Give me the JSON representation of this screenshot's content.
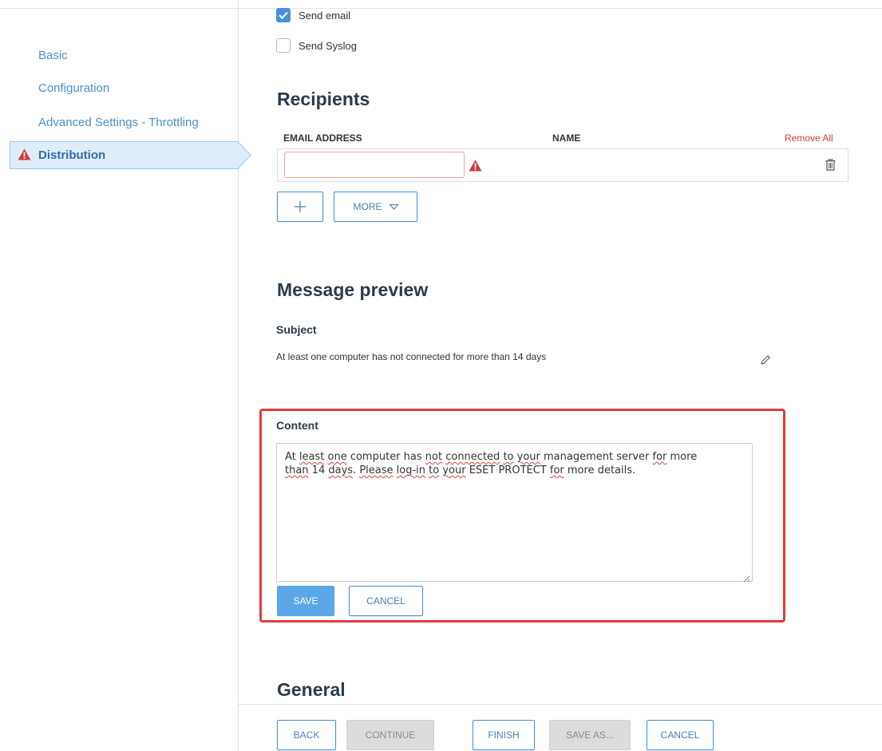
{
  "sidebar": {
    "items": [
      {
        "label": "Basic"
      },
      {
        "label": "Configuration"
      },
      {
        "label": "Advanced Settings - Throttling"
      },
      {
        "label": "Distribution",
        "active": true,
        "warning": true
      }
    ]
  },
  "distribution": {
    "send_email": {
      "label": "Send email",
      "checked": true
    },
    "send_syslog": {
      "label": "Send Syslog",
      "checked": false
    }
  },
  "recipients": {
    "title": "Recipients",
    "col_email": "EMAIL ADDRESS",
    "col_name": "NAME",
    "remove_all": "Remove All",
    "row": {
      "email_value": "",
      "has_error": true
    },
    "add_button_icon": "plus-icon",
    "more_label": "MORE"
  },
  "message_preview": {
    "title": "Message preview",
    "subject_label": "Subject",
    "subject_text": "At least one computer has not connected for more than 14 days",
    "content_label": "Content",
    "content_line1": [
      {
        "t": "At ",
        "sp": false
      },
      {
        "t": "least",
        "sp": true
      },
      {
        "t": " ",
        "sp": false
      },
      {
        "t": "one",
        "sp": true
      },
      {
        "t": " computer has ",
        "sp": false
      },
      {
        "t": "not",
        "sp": true
      },
      {
        "t": " ",
        "sp": false
      },
      {
        "t": "connected",
        "sp": true
      },
      {
        "t": " ",
        "sp": false
      },
      {
        "t": "to",
        "sp": true
      },
      {
        "t": " ",
        "sp": false
      },
      {
        "t": "your",
        "sp": true
      },
      {
        "t": " management server ",
        "sp": false
      },
      {
        "t": "for",
        "sp": true
      },
      {
        "t": " more",
        "sp": false
      }
    ],
    "content_line2": [
      {
        "t": "than",
        "sp": true
      },
      {
        "t": " 14 ",
        "sp": false
      },
      {
        "t": "days",
        "sp": true
      },
      {
        "t": ". ",
        "sp": false
      },
      {
        "t": "Please",
        "sp": true
      },
      {
        "t": " ",
        "sp": false
      },
      {
        "t": "log-in",
        "sp": true
      },
      {
        "t": " ",
        "sp": false
      },
      {
        "t": "to",
        "sp": true
      },
      {
        "t": " ",
        "sp": false
      },
      {
        "t": "your",
        "sp": true
      },
      {
        "t": " ESET PROTECT ",
        "sp": false
      },
      {
        "t": "for",
        "sp": true
      },
      {
        "t": " more details.",
        "sp": false
      }
    ],
    "save_label": "SAVE",
    "cancel_label": "CANCEL"
  },
  "general": {
    "title": "General"
  },
  "footer": {
    "back": "BACK",
    "continue": "CONTINUE",
    "finish": "FINISH",
    "save_as": "SAVE AS...",
    "cancel": "CANCEL"
  },
  "colors": {
    "accent": "#4a90d9",
    "nav_link": "#4a90c8",
    "warning": "#d0393a",
    "highlight_border": "#e03c3c"
  }
}
